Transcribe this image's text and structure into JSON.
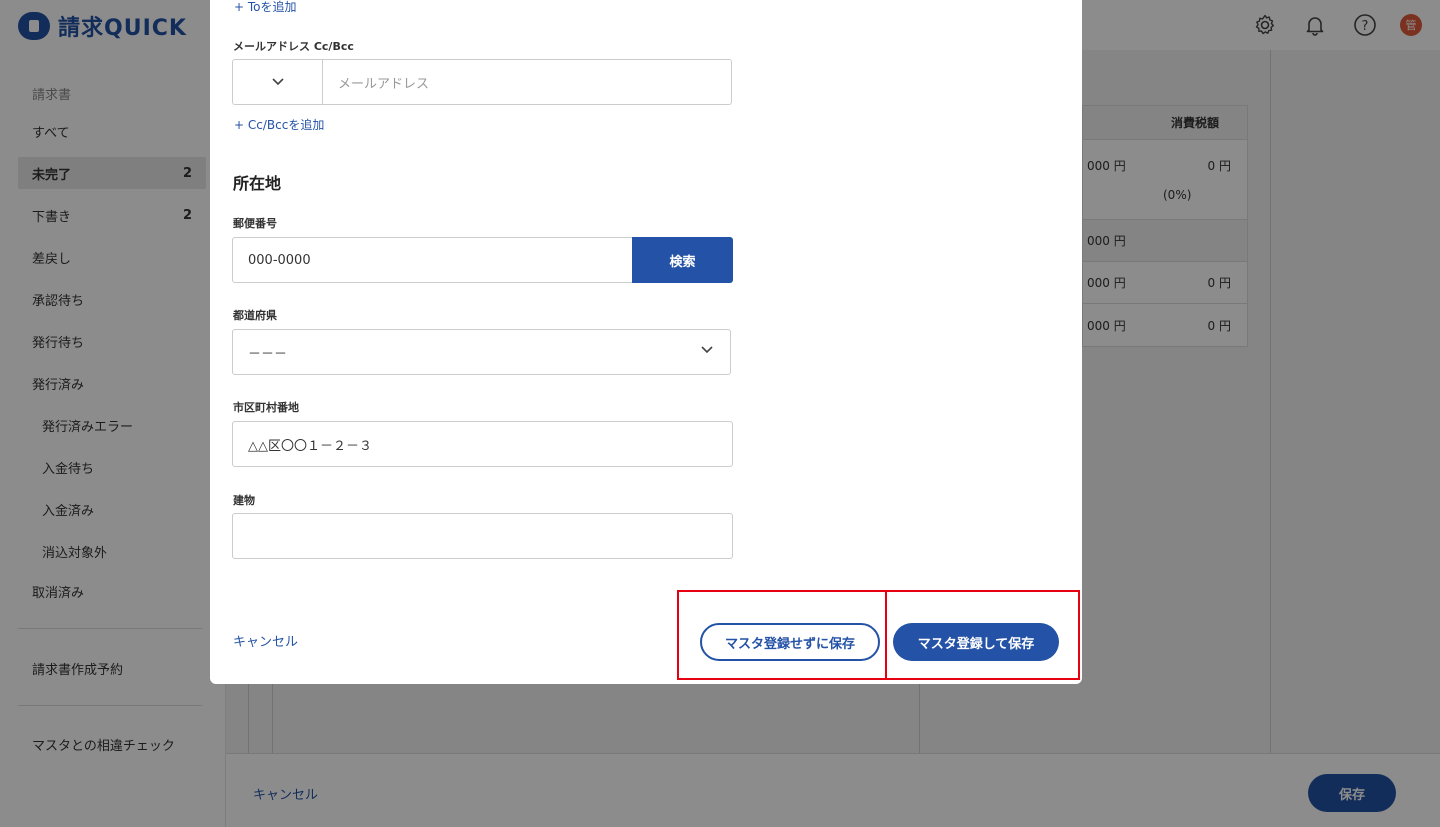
{
  "app": {
    "logo_text": "請求QUICK",
    "avatar_label": "管"
  },
  "sidebar": {
    "heading": "請求書",
    "items": [
      {
        "label": "すべて",
        "count": ""
      },
      {
        "label": "未完了",
        "count": "2"
      },
      {
        "label": "下書き",
        "count": "2"
      },
      {
        "label": "差戻し",
        "count": ""
      },
      {
        "label": "承認待ち",
        "count": ""
      },
      {
        "label": "発行待ち",
        "count": ""
      },
      {
        "label": "発行済み",
        "count": ""
      },
      {
        "label": "発行済みエラー",
        "count": ""
      },
      {
        "label": "入金待ち",
        "count": ""
      },
      {
        "label": "入金済み",
        "count": ""
      },
      {
        "label": "消込対象外",
        "count": ""
      },
      {
        "label": "取消済み",
        "count": ""
      }
    ],
    "reservation": "請求書作成予約",
    "master_check": "マスタとの相違チェック"
  },
  "background_table": {
    "header": "消費税額",
    "rows": [
      {
        "left": "000 円",
        "right": "0 円",
        "note": "(0%)"
      },
      {
        "left": "000 円",
        "right": ""
      },
      {
        "left": "000 円",
        "right": "0 円"
      },
      {
        "left": "000 円",
        "right": "0 円"
      }
    ]
  },
  "footer": {
    "cancel": "キャンセル",
    "save": "保存"
  },
  "modal": {
    "add_to": "+ Toを追加",
    "cc_label": "メールアドレス Cc/Bcc",
    "cc_placeholder": "メールアドレス",
    "add_cc": "+ Cc/Bccを追加",
    "section_title": "所在地",
    "postal_label": "郵便番号",
    "postal_value": "000-0000",
    "search_button": "検索",
    "prefecture_label": "都道府県",
    "prefecture_value": "－－－",
    "city_label": "市区町村番地",
    "city_value": "△△区〇〇１－２－３",
    "building_label": "建物",
    "building_value": "",
    "cancel": "キャンセル",
    "save_without_master": "マスタ登録せずに保存",
    "save_with_master": "マスタ登録して保存"
  },
  "colors": {
    "accent": "#2452a6",
    "highlight": "#e60012"
  }
}
